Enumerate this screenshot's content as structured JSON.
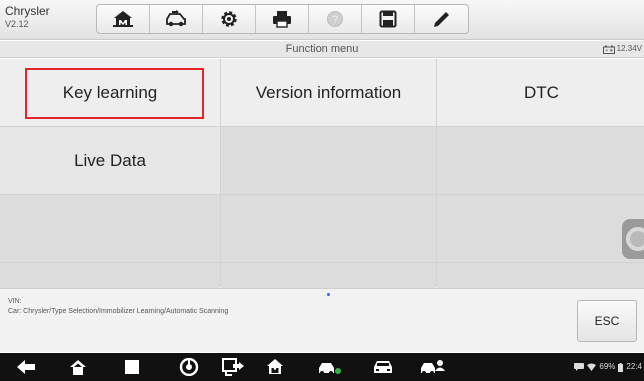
{
  "app": {
    "name": "Chrysler",
    "version": "V2.12"
  },
  "toolbar": {
    "buttons": [
      {
        "icon": "home-icon"
      },
      {
        "icon": "vehicle-swap-icon"
      },
      {
        "icon": "settings-gear-icon"
      },
      {
        "icon": "print-icon"
      },
      {
        "icon": "help-icon"
      },
      {
        "icon": "save-icon"
      },
      {
        "icon": "pen-icon"
      }
    ]
  },
  "header": {
    "title": "Function menu",
    "voltage": "12.34V"
  },
  "menu": {
    "items": [
      "Key learning",
      "Version information",
      "DTC",
      "Live Data",
      "",
      "",
      "",
      "",
      "",
      "",
      "",
      ""
    ],
    "selected_index": 0
  },
  "footer": {
    "vin_label": "VIN:",
    "car_path": "Car: Chrysler/Type Selection/Immobilizer Learning/Automatic Scanning",
    "esc_label": "ESC"
  },
  "statusbar": {
    "battery": "69%",
    "time": "22:4"
  },
  "colors": {
    "highlight": "#e1252b",
    "indicator": "#2a6fd6"
  }
}
